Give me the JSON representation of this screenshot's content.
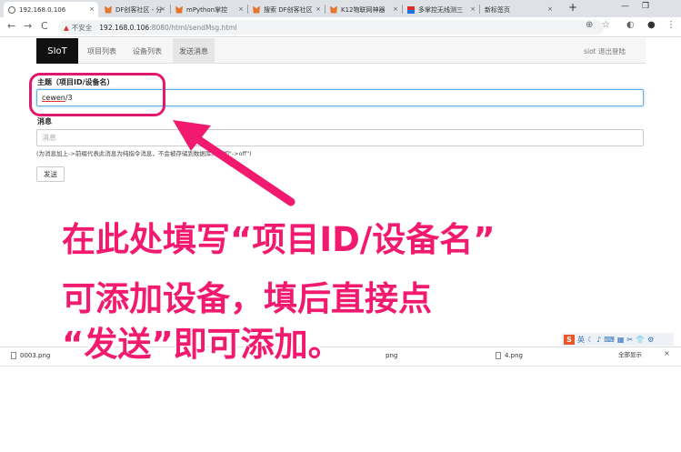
{
  "browser": {
    "tabs": [
      {
        "label": "192.168.0.106",
        "active": true
      },
      {
        "label": "DF创客社区 - 分"
      },
      {
        "label": "mPython掌控"
      },
      {
        "label": "搜索 DF创客社区"
      },
      {
        "label": "K12物联网神器"
      },
      {
        "label": "多掌控无线测三"
      },
      {
        "label": "新标签页"
      }
    ],
    "new_tab": "+",
    "tab_close": "×",
    "insecure_label": "不安全",
    "url_host": "192.168.0.106",
    "url_path": ":8080/html/sendMsg.html",
    "minimize": "—",
    "restore": "❐",
    "back": "←",
    "forward": "→",
    "reload": "C",
    "zoom": "⊕",
    "star": "☆",
    "ext": "◐",
    "profile": "●",
    "menu": "⋮"
  },
  "nav": {
    "brand": "SIoT",
    "items": [
      "项目列表",
      "设备列表",
      "发送消息"
    ],
    "active_index": 2,
    "logout": "siot 退出登陆"
  },
  "form": {
    "topic_label": "主题（项目ID/设备名）",
    "topic_value_underlined": "cewen",
    "topic_value_rest": "/3",
    "message_label": "消息",
    "message_placeholder": "消息",
    "hint": "(为消息加上->前缀代表此消息为纯指令消息，不会被存储到数据库。例如\"->off\")",
    "hint_overlap": "-",
    "send_button": "发送"
  },
  "annotation": {
    "line1": "在此处填写“项目ID/设备名”",
    "line2": "可添加设备，填后直接点",
    "line3": "“发送”即可添加。",
    "color": "#f21a6f"
  },
  "tray": {
    "s_icon": "S",
    "icons": [
      "英",
      "☾",
      "♪",
      "⌨",
      "▦",
      "✂",
      "👕",
      "⚙"
    ]
  },
  "downloads": {
    "items": [
      "0003.png",
      "png",
      "4.png"
    ],
    "show_all": "全部显示",
    "close": "×"
  }
}
